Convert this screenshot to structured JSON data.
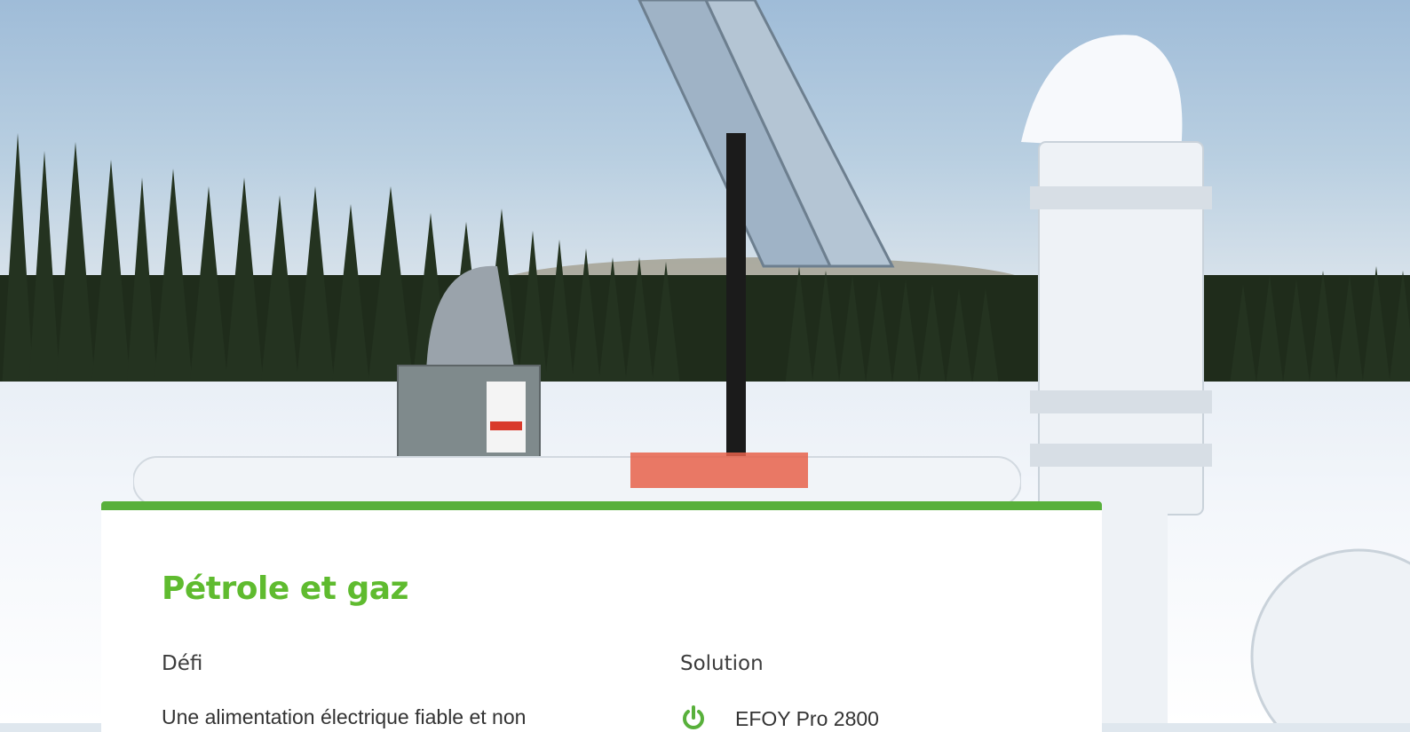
{
  "section": {
    "title": "Pétrole et gaz"
  },
  "defi": {
    "heading": "Défi",
    "text": "Une alimentation électrique fiable et non"
  },
  "solution": {
    "heading": "Solution",
    "items": [
      {
        "icon": "power-icon",
        "label": "EFOY Pro 2800"
      }
    ]
  },
  "colors": {
    "accent": "#58b03b",
    "title": "#5fbb2f"
  }
}
